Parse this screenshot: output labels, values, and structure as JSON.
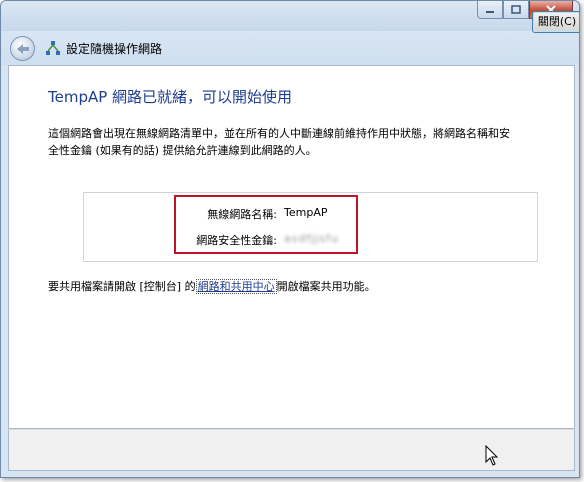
{
  "window": {
    "title": "設定隨機操作網路"
  },
  "content": {
    "heading": "TempAP 網路已就緒，可以開始使用",
    "description": "這個網路會出現在無線網路清單中，並在所有的人中斷連線前維持作用中狀態，將網路名稱和安全性金鑰 (如果有的話) 提供給允許連線到此網路的人。",
    "network_name_label": "無線網路名稱:",
    "network_name_value": "TempAP",
    "security_key_label": "網路安全性金鑰:",
    "security_key_value": "asdfjjsfu",
    "share_prefix": "要共用檔案請開啟 [控制台] 的",
    "share_link": "網路和共用中心",
    "share_suffix": "開啟檔案共用功能。"
  },
  "buttons": {
    "close_label": "關閉(C)"
  },
  "icons": {
    "back": "back-arrow-icon",
    "network": "network-icon",
    "minimize": "minimize-icon",
    "maximize": "maximize-icon",
    "close": "close-icon",
    "cursor": "mouse-cursor-icon"
  },
  "colors": {
    "heading": "#1e3d8f",
    "highlight_border": "#c0142a",
    "link": "#1e3d8f"
  }
}
